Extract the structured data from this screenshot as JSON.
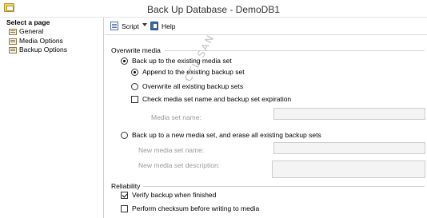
{
  "window": {
    "title": "Back Up Database - DemoDB1",
    "app_icon": "database-backup-icon"
  },
  "left_pane": {
    "header": "Select a page",
    "pages": [
      {
        "label": "General",
        "icon": "page-icon"
      },
      {
        "label": "Media Options",
        "icon": "page-icon"
      },
      {
        "label": "Backup Options",
        "icon": "page-icon"
      }
    ]
  },
  "toolbar": {
    "script_label": "Script",
    "help_label": "Help"
  },
  "overwrite_media": {
    "label": "Overwrite media",
    "existing_set": {
      "label": "Back up to the existing media set",
      "selected": true
    },
    "append": {
      "label": "Append to the existing backup set",
      "selected": true
    },
    "overwrite": {
      "label": "Overwrite all existing backup sets",
      "selected": false
    },
    "check_name": {
      "label": "Check media set name and backup set expiration",
      "checked": false
    },
    "media_set_name_label": "Media set name:",
    "media_set_name_value": "",
    "new_set": {
      "label": "Back up to a new media set, and erase all existing backup sets",
      "selected": false
    },
    "new_media_set_name_label": "New media set name:",
    "new_media_set_name_value": "",
    "new_media_set_desc_label": "New media set description:",
    "new_media_set_desc_value": ""
  },
  "reliability": {
    "label": "Reliability",
    "verify": {
      "label": "Verify backup when finished",
      "checked": true
    },
    "checksum": {
      "label": "Perform checksum before writing to media",
      "checked": false
    }
  },
  "watermark": "CTL.SAN"
}
